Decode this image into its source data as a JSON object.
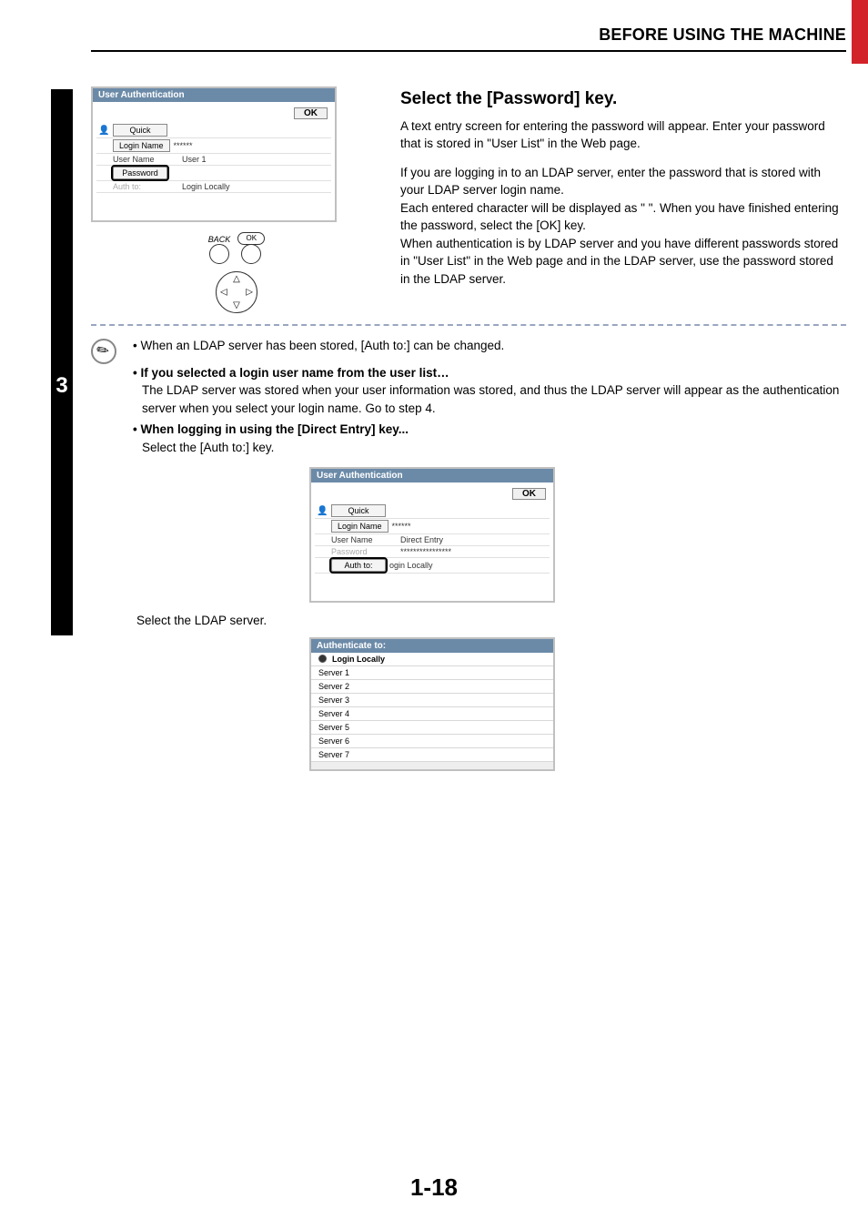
{
  "header": {
    "section_title": "BEFORE USING THE MACHINE"
  },
  "step_number": "3",
  "lcd1": {
    "title": "User Authentication",
    "ok_label": "OK",
    "quick_label": "Quick",
    "login_name_label": "Login Name",
    "login_name_value": "******",
    "user_name_label": "User Name",
    "user_name_value": "User 1",
    "password_label": "Password",
    "password_value": "",
    "auth_to_label": "Auth to:",
    "auth_to_value": "Login Locally"
  },
  "controls": {
    "back_label": "BACK",
    "ok_label": "OK"
  },
  "instruction": {
    "heading": "Select the [Password] key.",
    "para1": "A text entry screen for entering the password will appear. Enter your password that is stored in \"User List\" in the Web page.",
    "para2": "If you are logging in to an LDAP server, enter the password that is stored with your LDAP server login name.",
    "para3": "Each entered character will be displayed as \" \". When you have finished entering the password, select the [OK] key.",
    "para4": "When authentication is by LDAP server and you have different passwords stored in \"User List\" in the Web page and in the LDAP server, use the password stored in the LDAP server."
  },
  "note": {
    "line1": "When an LDAP server has been stored, [Auth to:] can be changed.",
    "bullet1_title": "If you selected a login user name from the user list…",
    "bullet1_body": "The LDAP server was stored when your user information was stored, and thus the LDAP server will appear as the authentication server when you select your login name. Go to step 4.",
    "bullet2_title": "When logging in using the [Direct Entry] key...",
    "bullet2_body": "Select the [Auth to:] key."
  },
  "lcd2": {
    "title": "User Authentication",
    "ok_label": "OK",
    "quick_label": "Quick",
    "login_name_label": "Login Name",
    "login_name_value": "******",
    "user_name_label": "User Name",
    "user_name_value": "Direct Entry",
    "password_label": "Password",
    "password_value": "****************",
    "auth_to_label": "Auth to:",
    "auth_to_value": "ogin Locally"
  },
  "select_ldap_text": "Select the LDAP server.",
  "auth_list": {
    "title": "Authenticate to:",
    "items": [
      "Login Locally",
      "Server 1",
      "Server 2",
      "Server 3",
      "Server 4",
      "Server 5",
      "Server 6",
      "Server 7"
    ]
  },
  "page_number": "1-18"
}
